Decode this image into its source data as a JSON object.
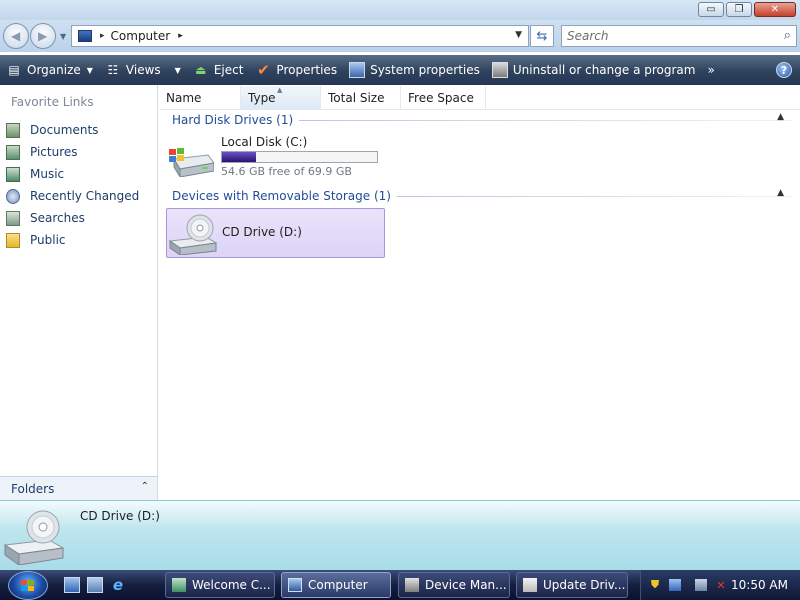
{
  "window": {
    "minimize_glyph": "▭",
    "maximize_glyph": "❐",
    "close_glyph": "✕"
  },
  "address_bar": {
    "location": "Computer",
    "separator": "▸",
    "search_placeholder": "Search",
    "icons": [
      "back-arrow-icon",
      "forward-arrow-icon",
      "computer-icon",
      "refresh-icon",
      "search-icon"
    ]
  },
  "toolbar": {
    "items": [
      {
        "label": "Organize",
        "icon": "organize-icon",
        "dropdown": true
      },
      {
        "label": "Views",
        "icon": "views-icon",
        "dropdown": true
      },
      {
        "label": "Eject",
        "icon": "eject-icon"
      },
      {
        "label": "Properties",
        "icon": "checkmark-icon"
      },
      {
        "label": "System properties",
        "icon": "system-properties-icon"
      },
      {
        "label": "Uninstall or change a program",
        "icon": "uninstall-icon"
      }
    ],
    "more": "»",
    "help": "?"
  },
  "sidebar": {
    "title": "Favorite Links",
    "items": [
      {
        "label": "Documents",
        "icon": "documents-icon"
      },
      {
        "label": "Pictures",
        "icon": "pictures-icon"
      },
      {
        "label": "Music",
        "icon": "music-icon"
      },
      {
        "label": "Recently Changed",
        "icon": "recently-changed-icon"
      },
      {
        "label": "Searches",
        "icon": "searches-icon"
      },
      {
        "label": "Public",
        "icon": "public-folder-icon"
      }
    ],
    "folders_label": "Folders"
  },
  "columns": [
    "Name",
    "Type",
    "Total Size",
    "Free Space"
  ],
  "groups": [
    {
      "label": "Hard Disk Drives (1)",
      "drives": [
        {
          "name": "Local Disk (C:)",
          "free_text": "54.6 GB free of 69.9 GB",
          "used_fraction": 0.22,
          "icon": "hard-disk-icon"
        }
      ]
    },
    {
      "label": "Devices with Removable Storage (1)",
      "drives": [
        {
          "name": "CD Drive (D:)",
          "icon": "cd-drive-icon",
          "selected": true
        }
      ]
    }
  ],
  "details": {
    "name": "CD Drive (D:)"
  },
  "taskbar": {
    "tasks": [
      {
        "label": "Welcome C...",
        "icon": "welcome-center-icon"
      },
      {
        "label": "Computer",
        "icon": "computer-icon",
        "active": true
      },
      {
        "label": "Device Man...",
        "icon": "device-manager-icon"
      },
      {
        "label": "Update Driv...",
        "icon": "update-driver-icon"
      }
    ],
    "clock": "10:50 AM"
  },
  "colors": {
    "toolbar": "#2f425d",
    "group_label": "#1f4c9a",
    "selection": "#ddd4f6",
    "disk_bar": "#2b126e",
    "details_pane": "#bfe6ee",
    "taskbar": "#151e3e"
  }
}
